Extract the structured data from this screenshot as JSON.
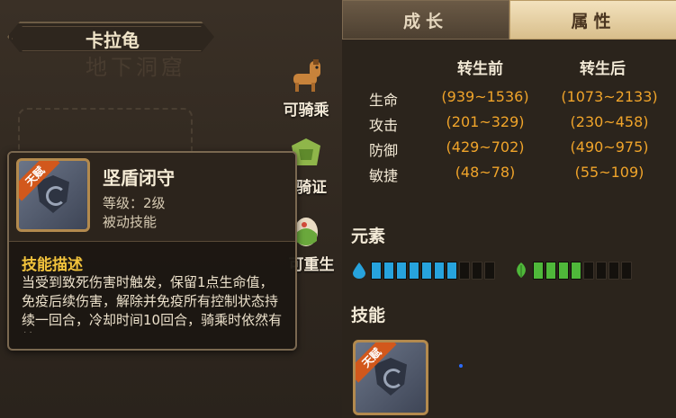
{
  "character": {
    "name": "卡拉龟",
    "location_ghost": "地下洞窟"
  },
  "actions": [
    {
      "label": "可骑乘",
      "icon": "horse-icon"
    },
    {
      "label": "骑证",
      "icon": "riding-license-icon"
    },
    {
      "label": "可重生",
      "icon": "rebirth-egg-icon"
    }
  ],
  "tooltip": {
    "badge": "天赋",
    "skill_name": "坚盾闭守",
    "level_text": "等级：2级",
    "type_text": "被动技能",
    "desc_title": "技能描述",
    "desc_text": "当受到致死伤害时触发，保留1点生命值，免疫后续伤害，解除并免疫所有控制状态持续一回合，冷却时间10回合，骑乘时依然有效。"
  },
  "tabs": [
    {
      "label": "成长",
      "active": false
    },
    {
      "label": "属性",
      "active": true
    }
  ],
  "stats": {
    "col_before": "转生前",
    "col_after": "转生后",
    "rows": [
      {
        "name": "生命",
        "before": "(939~1536)",
        "after": "(1073~2133)"
      },
      {
        "name": "攻击",
        "before": "(201~329)",
        "after": "(230~458)"
      },
      {
        "name": "防御",
        "before": "(429~702)",
        "after": "(490~975)"
      },
      {
        "name": "敏捷",
        "before": "(48~78)",
        "after": "(55~109)"
      }
    ]
  },
  "element": {
    "title": "元素",
    "water": {
      "icon": "water-drop-icon",
      "filled": 7,
      "total": 10,
      "color": "#27a3dd"
    },
    "wood": {
      "icon": "leaf-icon",
      "filled": 4,
      "total": 8,
      "color": "#4fb83a"
    }
  },
  "skills": {
    "title": "技能",
    "items": [
      {
        "badge": "天赋",
        "icon": "shield-swirl-icon"
      }
    ]
  }
}
